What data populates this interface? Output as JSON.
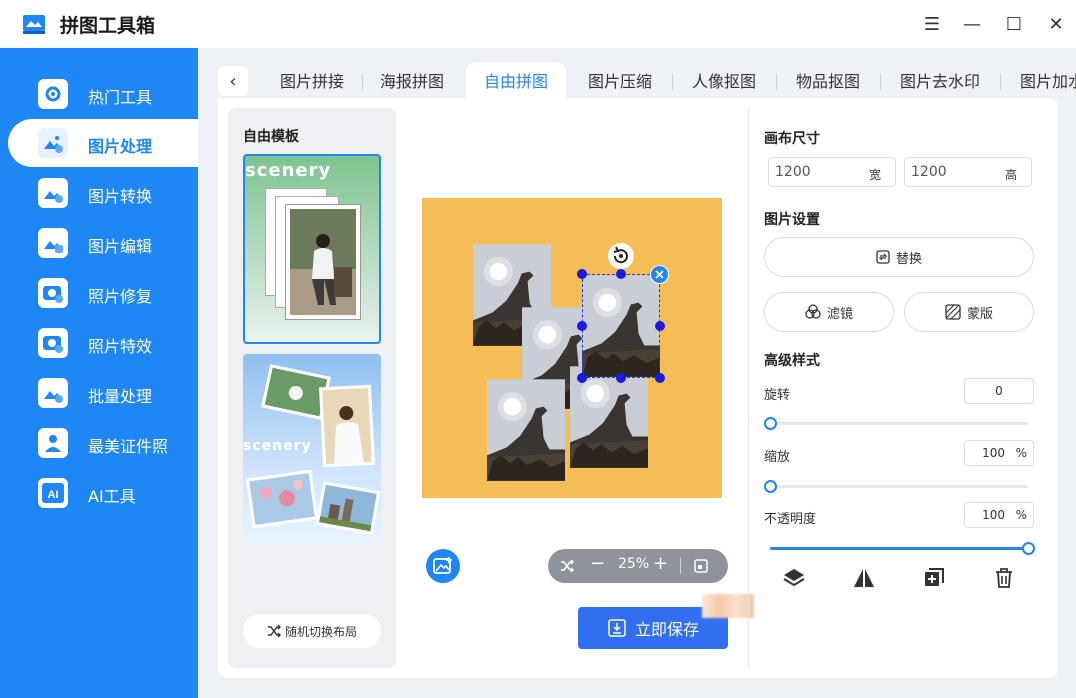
{
  "app": {
    "title": "拼图工具箱"
  },
  "window_controls": {
    "menu": "☰",
    "minimize": "—",
    "maximize": "☐",
    "close": "✕"
  },
  "sidebar": {
    "items": [
      {
        "label": "热门工具",
        "icon": "gear-tools-icon",
        "active": false
      },
      {
        "label": "图片处理",
        "icon": "image-process-icon",
        "active": true
      },
      {
        "label": "图片转换",
        "icon": "image-convert-icon",
        "active": false
      },
      {
        "label": "图片编辑",
        "icon": "image-edit-icon",
        "active": false
      },
      {
        "label": "照片修复",
        "icon": "photo-repair-icon",
        "active": false
      },
      {
        "label": "照片特效",
        "icon": "photo-effect-icon",
        "active": false
      },
      {
        "label": "批量处理",
        "icon": "batch-icon",
        "active": false
      },
      {
        "label": "最美证件照",
        "icon": "id-photo-icon",
        "active": false
      },
      {
        "label": "AI工具",
        "icon": "ai-icon",
        "active": false
      }
    ]
  },
  "tabs": {
    "back": "‹",
    "items": [
      {
        "label": "图片拼接",
        "active": false
      },
      {
        "label": "海报拼图",
        "active": false
      },
      {
        "label": "自由拼图",
        "active": true
      },
      {
        "label": "图片压缩",
        "active": false
      },
      {
        "label": "人像抠图",
        "active": false
      },
      {
        "label": "物品抠图",
        "active": false
      },
      {
        "label": "图片去水印",
        "active": false
      },
      {
        "label": "图片加水",
        "active": false
      }
    ]
  },
  "templates": {
    "title": "自由模板",
    "cards": [
      {
        "word": "scenery",
        "selected": true
      },
      {
        "word": "scenery",
        "selected": false
      }
    ],
    "random_label": "随机切换布局"
  },
  "zoom": {
    "value": "25%"
  },
  "save_label": "立即保存",
  "right_panel": {
    "canvas_size": {
      "title": "画布尺寸",
      "width": "1200",
      "width_unit": "宽",
      "height": "1200",
      "height_unit": "高"
    },
    "image_settings": {
      "title": "图片设置",
      "replace": "替换",
      "filter": "滤镜",
      "mask": "蒙版"
    },
    "advanced": {
      "title": "高级样式",
      "rotate": {
        "label": "旋转",
        "value": "0",
        "level": 0
      },
      "scale": {
        "label": "缩放",
        "value": "100",
        "unit": "%",
        "level": 0
      },
      "opacity": {
        "label": "不透明度",
        "value": "100",
        "unit": "%",
        "level": 1
      }
    },
    "tools": [
      "layers-icon",
      "flip-icon",
      "duplicate-icon",
      "delete-icon"
    ]
  },
  "colors": {
    "accent": "#1f86f5",
    "canvas_bg": "#f5bd55",
    "save_btn": "#2f6ff0"
  }
}
